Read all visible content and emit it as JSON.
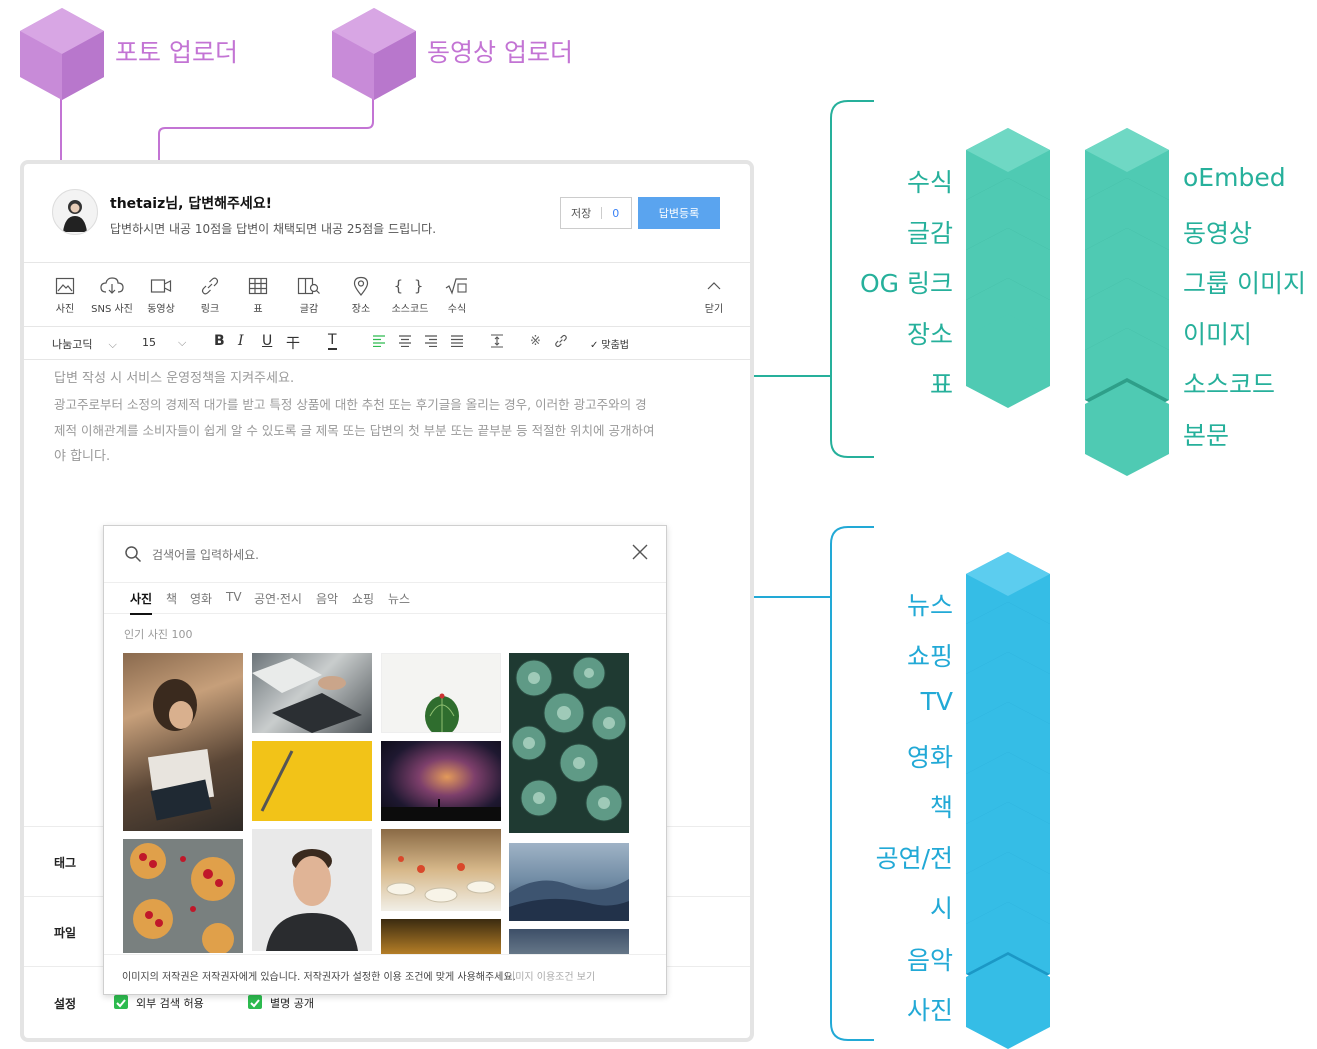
{
  "callouts": {
    "photo_uploader": "포토 업로더",
    "video_uploader": "동영상 업로더"
  },
  "header": {
    "user_name": "thetaiz",
    "user_suffix": "님, 답변해주세요!",
    "subtitle": "답변하시면 내공 10점을 답변이 채택되면 내공 25점을 드립니다.",
    "save_label": "저장",
    "save_count": "0",
    "submit_label": "답변등록"
  },
  "toolbar": {
    "items": [
      "사진",
      "SNS 사진",
      "동영상",
      "링크",
      "표",
      "글감",
      "장소",
      "소스코드",
      "수식"
    ],
    "close_label": "닫기"
  },
  "format_bar": {
    "font": "나눔고딕",
    "size": "15",
    "bold": "B",
    "italic": "I",
    "underline": "U",
    "strike": "干",
    "text_color": "T",
    "spellcheck": "맞춤법"
  },
  "editor": {
    "line1": "답변 작성 시 서비스 운영정책을 지켜주세요.",
    "line2": "광고주로부터 소정의 경제적 대가를 받고 특정 상품에 대한 추천 또는 후기글을 올리는 경우, 이러한 광고주와의 경",
    "line3": "제적 이해관계를 소비자들이 쉽게 알 수 있도록 글 제목 또는 답변의 첫 부분 또는 끝부분 등 적절한 위치에 공개하여",
    "line4": "야 합니다."
  },
  "sections": {
    "tag": "태그",
    "file": "파일",
    "settings": "설정",
    "opt_search": "외부 검색 허용",
    "opt_anon": "별명 공개"
  },
  "search_popup": {
    "placeholder": "검색어를 입력하세요.",
    "tabs": [
      "사진",
      "책",
      "영화",
      "TV",
      "공연·전시",
      "음악",
      "쇼핑",
      "뉴스"
    ],
    "caption": "인기 사진 100",
    "footer_text": "이미지의 저작권은 저작권자에게 있습니다. 저작권자가 설정한 이용 조건에 맞게 사용해주세요.",
    "footer_link": "이미지 이용조건 보기"
  },
  "toolbar_legend": {
    "left": [
      "수식",
      "글감",
      "OG 링크",
      "장소",
      "표"
    ],
    "right": [
      "oEmbed",
      "동영상",
      "그룹 이미지",
      "이미지",
      "소스코드",
      "본문"
    ]
  },
  "search_legend": [
    "뉴스",
    "쇼핑",
    "TV",
    "영화",
    "책",
    "공연/전",
    "시",
    "음악",
    "사진"
  ],
  "colors": {
    "purple": "#c374d4",
    "teal": "#26b09b",
    "blue": "#22a9d6",
    "accent_button": "#5aa4ef",
    "check_green": "#2dbb4f"
  }
}
